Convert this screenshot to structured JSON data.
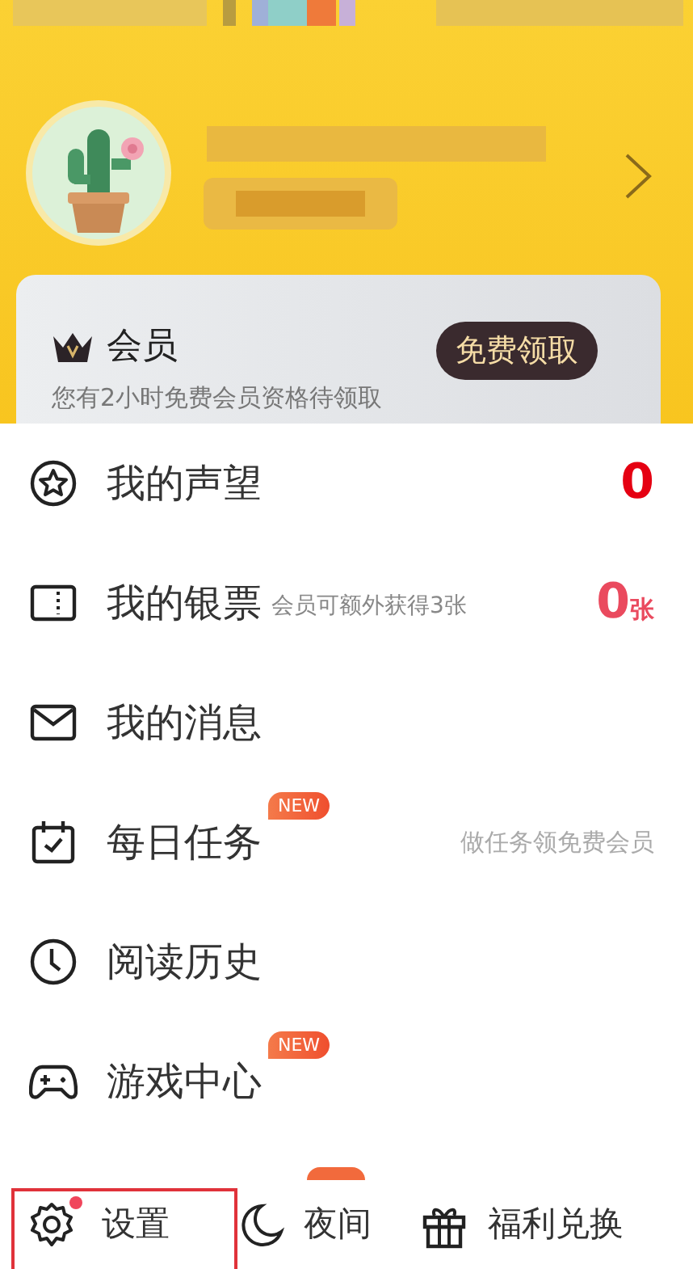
{
  "member_card": {
    "title": "会员",
    "button": "免费领取",
    "subtitle": "您有2小时免费会员资格待领取"
  },
  "menu": [
    {
      "kind": "star",
      "label": "我的声望",
      "value": "0"
    },
    {
      "kind": "ticket",
      "label": "我的银票",
      "note": "会员可额外获得3张",
      "value": "0",
      "unit": "张"
    },
    {
      "kind": "mail",
      "label": "我的消息"
    },
    {
      "kind": "calendar",
      "label": "每日任务",
      "badge": "NEW",
      "note_right": "做任务领免费会员"
    },
    {
      "kind": "clock",
      "label": "阅读历史"
    },
    {
      "kind": "gamepad",
      "label": "游戏中心",
      "badge": "NEW"
    }
  ],
  "bottom_bar": [
    {
      "kind": "gear",
      "label": "设置",
      "dot": true,
      "highlighted": true
    },
    {
      "kind": "moon",
      "label": "夜间",
      "dot": false,
      "highlighted": false
    },
    {
      "kind": "gift",
      "label": "福利兑换",
      "dot": false,
      "highlighted": false
    }
  ]
}
